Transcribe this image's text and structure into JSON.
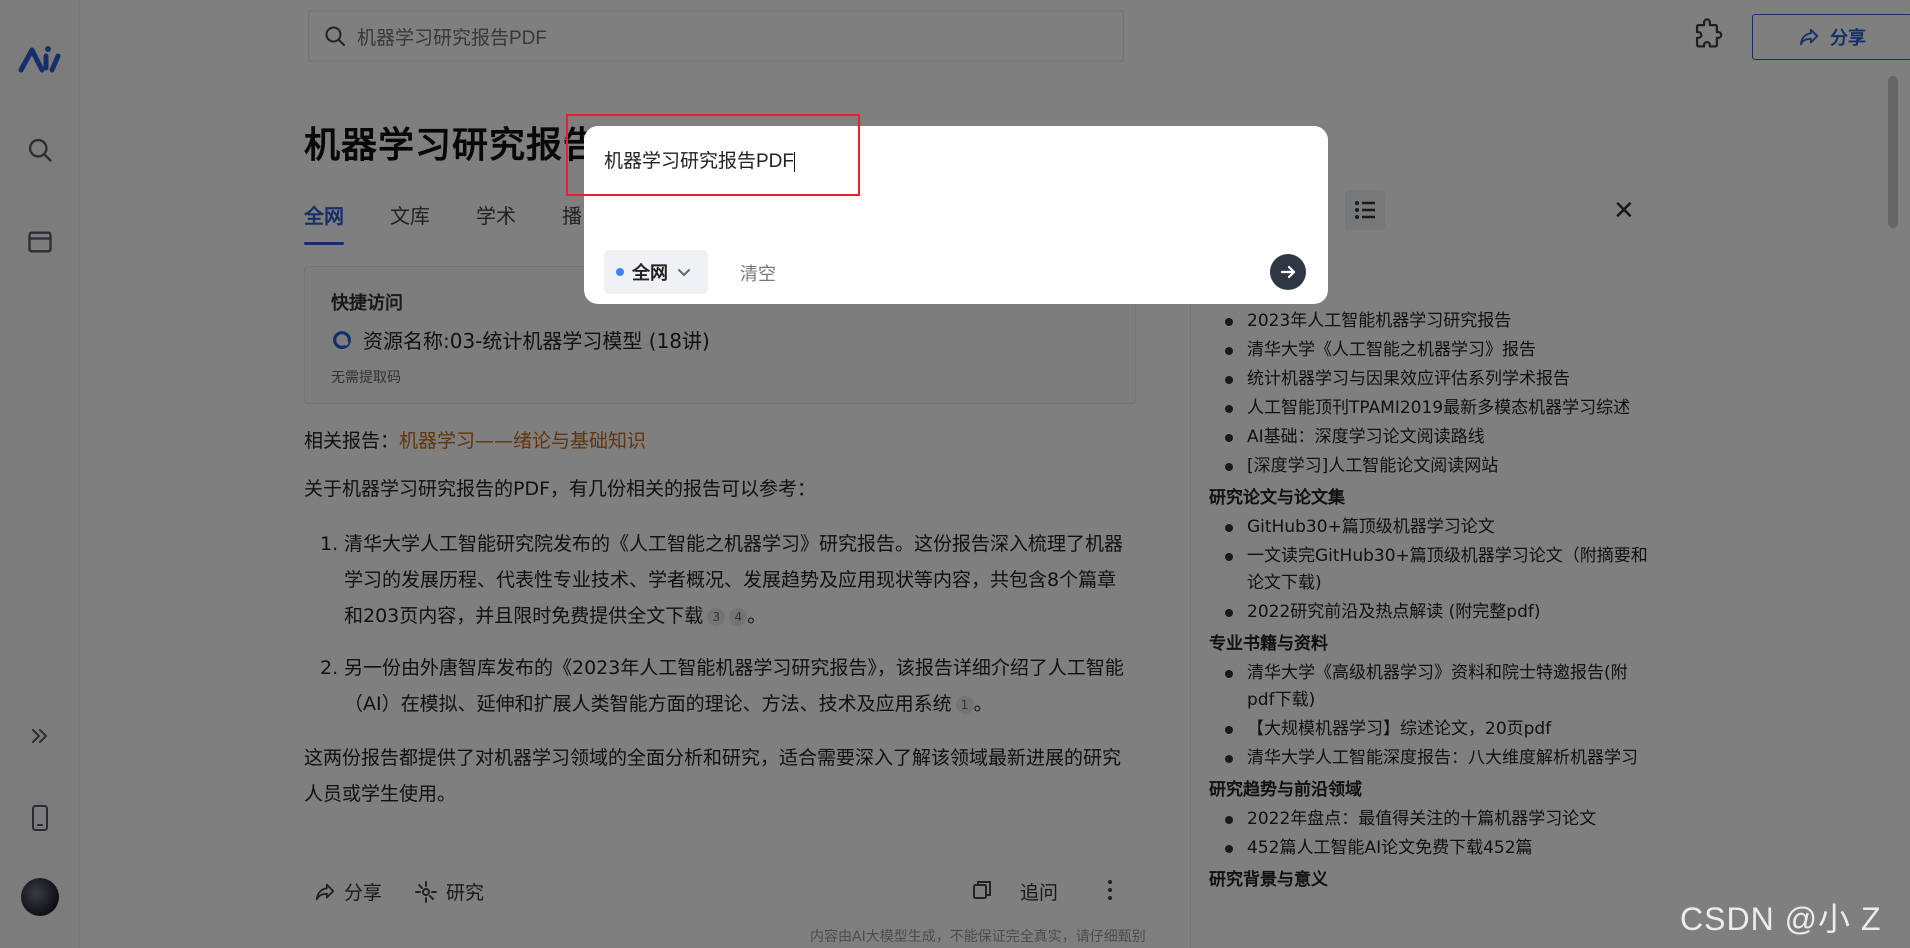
{
  "search": {
    "query": "机器学习研究报告PDF"
  },
  "header": {
    "share_label": "分享"
  },
  "page": {
    "title": "机器学习研究报告PDF"
  },
  "tabs": [
    {
      "label": "全网"
    },
    {
      "label": "文库"
    },
    {
      "label": "学术"
    },
    {
      "label": "播"
    }
  ],
  "quick_access": {
    "title": "快捷访问",
    "resource": "资源名称:03-统计机器学习模型 (18讲)",
    "note": "无需提取码"
  },
  "related": {
    "label": "相关报告：",
    "link": "机器学习——绪论与基础知识"
  },
  "intro": "关于机器学习研究报告的PDF，有几份相关的报告可以参考：",
  "items": [
    {
      "num": "1.",
      "text": "清华大学人工智能研究院发布的《人工智能之机器学习》研究报告。这份报告深入梳理了机器学习的发展历程、代表性专业技术、学者概况、发展趋势及应用现状等内容，共包含8个篇章和203页内容，并且限时免费提供全文下载",
      "cites": [
        "3",
        "4"
      ],
      "end": "。"
    },
    {
      "num": "2.",
      "text": "另一份由外唐智库发布的《2023年人工智能机器学习研究报告》，该报告详细介绍了人工智能（AI）在模拟、延伸和扩展人类智能方面的理论、方法、技术及应用系统",
      "cites": [
        "1"
      ],
      "end": "。"
    }
  ],
  "summary": "这两份报告都提供了对机器学习领域的全面分析和研究，适合需要深入了解该领域最新进展的研究人员或学生使用。",
  "actions": {
    "share": "分享",
    "research": "研究",
    "followup": "追问"
  },
  "disclaimer": "内容由AI大模型生成，不能保证完全真实，请仔细甄别",
  "outline": {
    "sections": [
      {
        "heading": "",
        "items": [
          "2023年人工智能机器学习研究报告",
          "清华大学《人工智能之机器学习》报告",
          "统计机器学习与因果效应评估系列学术报告",
          "人工智能顶刊TPAMI2019最新多模态机器学习综述",
          "AI基础：深度学习论文阅读路线",
          "[深度学习]人工智能论文阅读网站"
        ]
      },
      {
        "heading": "研究论文与论文集",
        "items": [
          "GitHub30+篇顶级机器学习论文",
          "一文读完GitHub30+篇顶级机器学习论文（附摘要和论文下载)",
          "2022研究前沿及热点解读 (附完整pdf)"
        ]
      },
      {
        "heading": "专业书籍与资料",
        "items": [
          "清华大学《高级机器学习》资料和院士特邀报告(附pdf下载)",
          "【大规模机器学习】综述论文，20页pdf",
          "清华大学人工智能深度报告：八大维度解析机器学习"
        ]
      },
      {
        "heading": "研究趋势与前沿领域",
        "items": [
          "2022年盘点：最值得关注的十篇机器学习论文",
          "452篇人工智能AI论文免费下载452篇"
        ]
      },
      {
        "heading": "研究背景与意义",
        "items": []
      }
    ]
  },
  "modal": {
    "query": "机器学习研究报告PDF",
    "scope": "全网",
    "clear_label": "清空"
  },
  "watermark": "CSDN @小 Z"
}
